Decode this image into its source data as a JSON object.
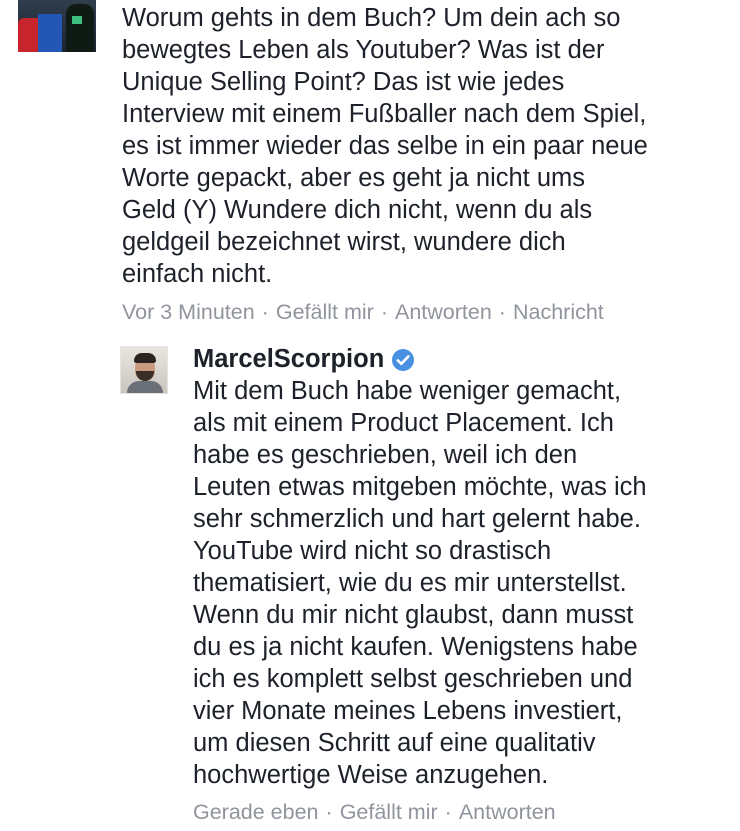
{
  "top_comment": {
    "text": "Worum gehts in dem Buch? Um dein ach so\nbewegtes Leben als Youtuber? Was ist der\nUnique Selling Point? Das ist wie jedes\nInterview mit einem Fußballer nach dem Spiel,\nes ist immer wieder das selbe in ein paar neue\nWorte gepackt, aber es geht ja nicht ums\nGeld (Y) Wundere dich nicht, wenn du als\ngeldgeil bezeichnet wirst, wundere dich\neinfach nicht.",
    "meta": {
      "time": "Vor 3 Minuten",
      "like": "Gefällt mir",
      "reply": "Antworten",
      "message": "Nachricht"
    }
  },
  "reply": {
    "author": "MarcelScorpion",
    "verified_color": "#4a90e2",
    "text": "Mit dem Buch habe weniger gemacht,\nals mit einem Product Placement. Ich\nhabe es geschrieben, weil ich den\nLeuten etwas mitgeben möchte, was ich\nsehr schmerzlich und hart gelernt habe.\nYouTube wird nicht so drastisch\nthematisiert, wie du es mir unterstellst.\nWenn du mir nicht glaubst, dann musst\ndu es ja nicht kaufen. Wenigstens habe\nich es komplett selbst geschrieben und\nvier Monate meines Lebens investiert,\num diesen Schritt auf eine qualitativ\nhochwertige Weise anzugehen.",
    "meta": {
      "time": "Gerade eben",
      "like": "Gefällt mir",
      "reply": "Antworten"
    }
  },
  "separator": "·",
  "colors": {
    "text": "#1d2129",
    "meta": "#90949c",
    "verified": "#4a90e2"
  },
  "icons": {
    "verified": "verified-badge-icon"
  }
}
